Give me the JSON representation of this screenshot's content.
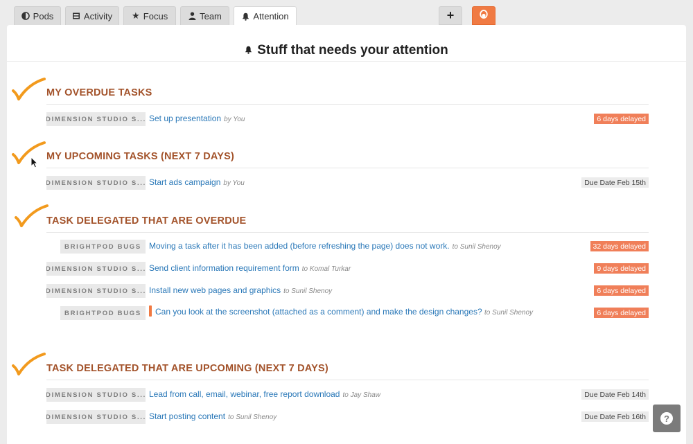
{
  "tabs": [
    {
      "label": "Pods",
      "icon": "pods-icon"
    },
    {
      "label": "Activity",
      "icon": "film-icon"
    },
    {
      "label": "Focus",
      "icon": "star-icon"
    },
    {
      "label": "Team",
      "icon": "person-icon"
    },
    {
      "label": "Attention",
      "icon": "bell-icon",
      "active": true
    }
  ],
  "toolbar": {
    "add_label": "+"
  },
  "page": {
    "title": "Stuff that needs your attention"
  },
  "sections": {
    "overdue": {
      "heading": "MY OVERDUE TASKS",
      "rows": [
        {
          "project": "DIMENSION STUDIO S...",
          "task": "Set up presentation",
          "by": "by You",
          "status": "6 days delayed"
        }
      ]
    },
    "upcoming": {
      "heading": "MY UPCOMING TASKS (NEXT 7 DAYS)",
      "rows": [
        {
          "project": "DIMENSION STUDIO S...",
          "task": "Start ads campaign",
          "by": "by You",
          "status": "Due Date Feb 15th"
        }
      ]
    },
    "delegated_overdue": {
      "heading": "TASK DELEGATED THAT ARE OVERDUE",
      "rows": [
        {
          "project": "BRIGHTPOD BUGS",
          "task": "Moving a task after it has been added (before refreshing the page) does not work.",
          "by": "to Sunil Shenoy",
          "status": "32 days delayed"
        },
        {
          "project": "DIMENSION STUDIO S...",
          "task": "Send client information requirement form",
          "by": "to Komal Turkar",
          "status": "9 days delayed"
        },
        {
          "project": "DIMENSION STUDIO S...",
          "task": "Install new web pages and graphics",
          "by": "to Sunil Shenoy",
          "status": "6 days delayed"
        },
        {
          "project": "BRIGHTPOD BUGS",
          "task": "Can you look at the screenshot (attached as a comment) and make the design changes?",
          "by": "to Sunil Shenoy",
          "status": "6 days delayed"
        }
      ]
    },
    "delegated_upcoming": {
      "heading": "TASK DELEGATED THAT ARE UPCOMING (NEXT 7 DAYS)",
      "rows": [
        {
          "project": "DIMENSION STUDIO S...",
          "task": "Lead from call, email, webinar, free report download",
          "by": "to Jay Shaw",
          "status": "Due Date Feb 14th"
        },
        {
          "project": "DIMENSION STUDIO S...",
          "task": "Start posting content",
          "by": "to Sunil Shenoy",
          "status": "Due Date Feb 16th"
        }
      ]
    }
  },
  "help": {
    "label": "?"
  },
  "colors": {
    "accent": "#f07a43",
    "heading": "#a3532b",
    "link": "#2a78b8",
    "delayed": "#f07f59",
    "check": "#f29a1d"
  }
}
